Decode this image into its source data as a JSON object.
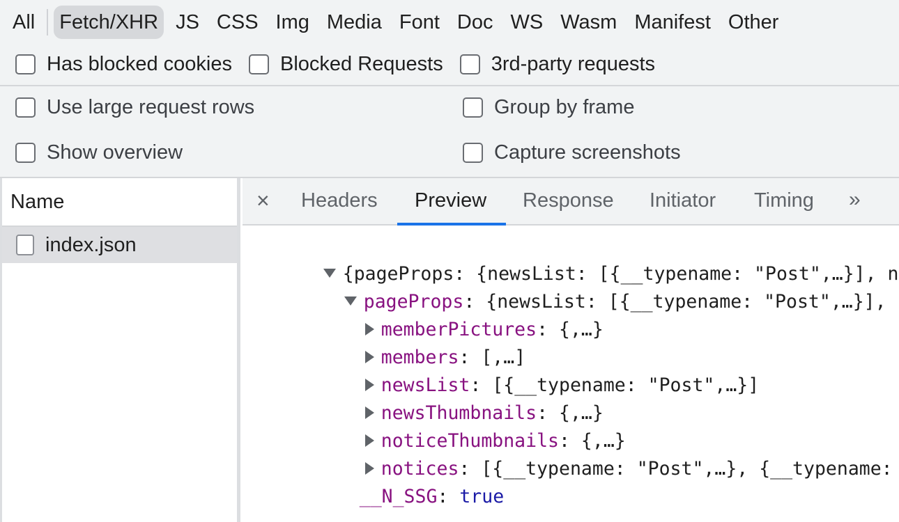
{
  "filter_bar": {
    "types": [
      "All",
      "Fetch/XHR",
      "JS",
      "CSS",
      "Img",
      "Media",
      "Font",
      "Doc",
      "WS",
      "Wasm",
      "Manifest",
      "Other"
    ],
    "active_type": "Fetch/XHR",
    "checkboxes": [
      {
        "label": "Has blocked cookies",
        "checked": false
      },
      {
        "label": "Blocked Requests",
        "checked": false
      },
      {
        "label": "3rd-party requests",
        "checked": false
      }
    ]
  },
  "settings": {
    "use_large_rows": "Use large request rows",
    "group_by_frame": "Group by frame",
    "show_overview": "Show overview",
    "capture_screenshots": "Capture screenshots"
  },
  "request_list": {
    "header": "Name",
    "rows": [
      {
        "name": "index.json",
        "selected": true
      }
    ]
  },
  "detail_tabs": {
    "close_glyph": "×",
    "tabs": [
      "Headers",
      "Preview",
      "Response",
      "Initiator",
      "Timing"
    ],
    "active": "Preview",
    "more_glyph": "»"
  },
  "preview": {
    "root_summary": "{pageProps: {newsList: [{__typename: \"Post\",…}], newsThumbnails: {,…},…}",
    "pageProps_key": "pageProps",
    "pageProps_summary": ": {newsList: [{__typename: \"Post\",…}], newsThumbnails: {,…},…}",
    "entries": [
      {
        "key": "memberPictures",
        "value": ": {,…}"
      },
      {
        "key": "members",
        "value": ": [,…]"
      },
      {
        "key": "newsList",
        "value": ": [{__typename: \"Post\",…}]"
      },
      {
        "key": "newsThumbnails",
        "value": ": {,…}"
      },
      {
        "key": "noticeThumbnails",
        "value": ": {,…}"
      },
      {
        "key": "notices",
        "value": ": [{__typename: \"Post\",…}, {__typename: \"Post\",…}]"
      }
    ],
    "nssg_key": "__N_SSG",
    "nssg_sep": ": ",
    "nssg_value": "true"
  },
  "colors": {
    "accent": "#1a73e8",
    "key": "#881280",
    "boolean": "#1a1aa6",
    "toolbar_bg": "#f1f3f4",
    "selected_row": "#dedfe2"
  }
}
